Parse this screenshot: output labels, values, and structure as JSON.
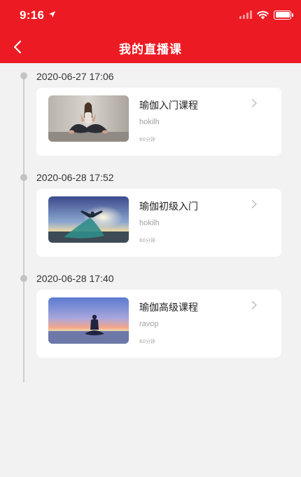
{
  "status_bar": {
    "time": "9:16"
  },
  "header": {
    "title": "我的直播课"
  },
  "entries": [
    {
      "date": "2020-06-27 17:06",
      "title": "瑜伽入门课程",
      "teacher": "hokilh",
      "duration": "60分钟",
      "thumb": "yoga-woman-seated-photo"
    },
    {
      "date": "2020-06-28 17:52",
      "title": "瑜伽初级入门",
      "teacher": "hokilh",
      "duration": "60分钟",
      "thumb": "yoga-pose-sunset-photo"
    },
    {
      "date": "2020-06-28 17:40",
      "title": "瑜伽高级课程",
      "teacher": "ravop",
      "duration": "60分钟",
      "thumb": "meditation-beach-sunset-photo"
    }
  ],
  "colors": {
    "header_bg": "#ec1b23",
    "page_bg": "#f2f2f2"
  }
}
